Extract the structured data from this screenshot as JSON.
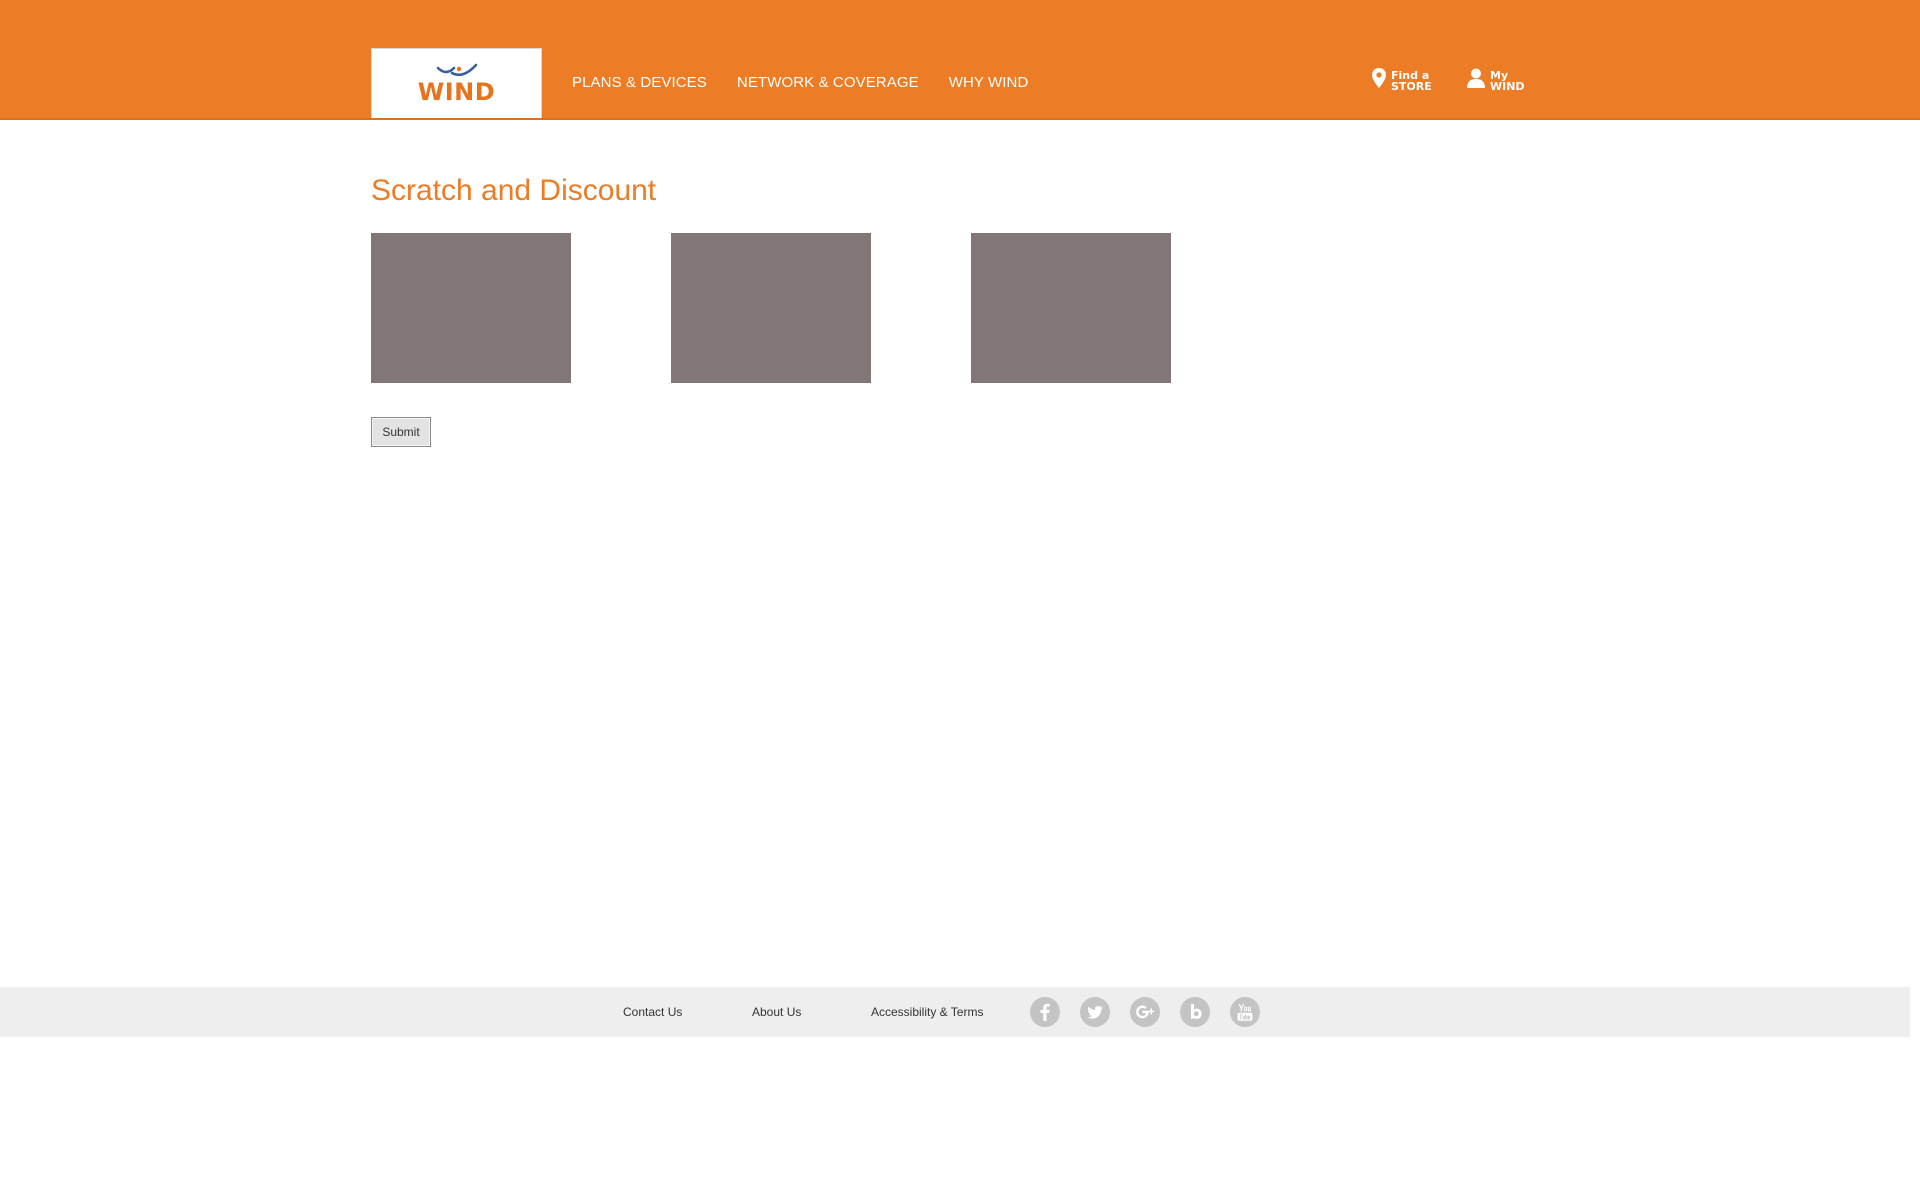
{
  "header": {
    "logo_text": "WIND",
    "nav": [
      {
        "label": "PLANS & DEVICES"
      },
      {
        "label": "NETWORK & COVERAGE"
      },
      {
        "label": "WHY WIND"
      }
    ],
    "find_store": {
      "line1": "Find a",
      "line2": "STORE",
      "icon": "location-pin-icon"
    },
    "my_wind": {
      "line1": "My",
      "line2": "WIND",
      "icon": "user-icon"
    }
  },
  "main": {
    "title": "Scratch and Discount",
    "submit_label": "Submit"
  },
  "footer": {
    "links": [
      {
        "label": "Contact Us"
      },
      {
        "label": "About Us"
      },
      {
        "label": "Accessibility & Terms"
      }
    ],
    "social": [
      "facebook-icon",
      "twitter-icon",
      "google-plus-icon",
      "blog-icon",
      "youtube-icon"
    ]
  },
  "colors": {
    "brand_orange": "#ec7c25",
    "scratch_card": "#807776",
    "footer_bg": "#eeeeee",
    "social_icon": "#c4c4c4"
  }
}
